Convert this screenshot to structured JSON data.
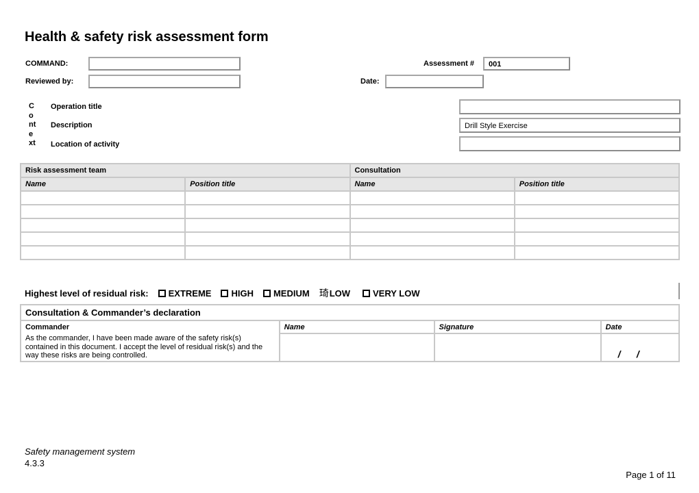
{
  "header": {
    "title": "Health & safety risk assessment form"
  },
  "fields": {
    "command_label": "COMMAND:",
    "command_value": "",
    "reviewed_label": "Reviewed by:",
    "reviewed_value": "",
    "assessment_label": "Assessment #",
    "assessment_value": "001",
    "date_label": "Date:",
    "date_value": ""
  },
  "context": {
    "side_label_lines": [
      "C",
      "o",
      "nt",
      "e",
      "xt"
    ],
    "operation_title_label": "Operation  title",
    "operation_title_value": "",
    "description_label": "Description",
    "description_value": "Drill Style Exercise",
    "location_label": "Location of activity",
    "location_value": ""
  },
  "team_table": {
    "risk_team_header": "Risk assessment team",
    "consultation_header": "Consultation",
    "columns": [
      "Name",
      "Position title",
      "Name",
      "Position title"
    ],
    "rows": [
      [
        "",
        "",
        "",
        ""
      ],
      [
        "",
        "",
        "",
        ""
      ],
      [
        "",
        "",
        "",
        ""
      ],
      [
        "",
        "",
        "",
        ""
      ],
      [
        "",
        "",
        "",
        ""
      ]
    ]
  },
  "residual_risk": {
    "label": "Highest level of residual risk:",
    "options": [
      {
        "label": "EXTREME",
        "checked": false,
        "marker": ""
      },
      {
        "label": "HIGH",
        "checked": false,
        "marker": ""
      },
      {
        "label": "MEDIUM",
        "checked": false,
        "marker": ""
      },
      {
        "label": "LOW",
        "checked": true,
        "marker": "琦"
      },
      {
        "label": "VERY LOW",
        "checked": false,
        "marker": ""
      }
    ]
  },
  "declaration": {
    "title": "Consultation & Commander’s declaration",
    "commander_label": "Commander",
    "statement": "As the commander, I have been made aware of the safety risk(s) contained in this document.  I accept the level of residual risk(s) and the way these risks are being controlled.",
    "name_header": "Name",
    "signature_header": "Signature",
    "date_header": "Date",
    "name_value": "",
    "signature_value": "",
    "date_value": "/      /"
  },
  "footer": {
    "system": "Safety management system",
    "version": "4.3.3",
    "page": "Page 1 of 11"
  }
}
